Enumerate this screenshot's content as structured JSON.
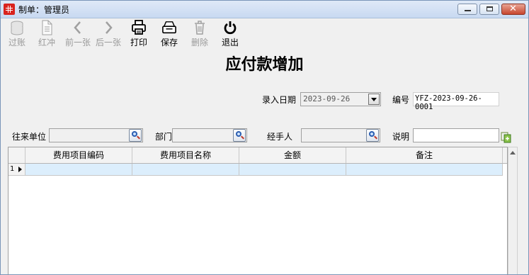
{
  "window": {
    "title": "制单：管理员"
  },
  "toolbar": {
    "items": [
      {
        "label": "过账",
        "icon": "coins-icon",
        "enabled": false
      },
      {
        "label": "红冲",
        "icon": "document-icon",
        "enabled": false
      },
      {
        "label": "前一张",
        "icon": "chevron-left-icon",
        "enabled": false
      },
      {
        "label": "后一张",
        "icon": "chevron-right-icon",
        "enabled": false
      },
      {
        "label": "打印",
        "icon": "printer-icon",
        "enabled": true
      },
      {
        "label": "保存",
        "icon": "save-box-icon",
        "enabled": true
      },
      {
        "label": "删除",
        "icon": "trash-icon",
        "enabled": false
      },
      {
        "label": "退出",
        "icon": "power-icon",
        "enabled": true
      }
    ]
  },
  "form": {
    "title": "应付款增加",
    "entry_date_label": "录入日期",
    "entry_date_value": "2023-09-26",
    "number_label": "编号",
    "number_value": "YFZ-2023-09-26-0001",
    "partner_label": "往来单位",
    "partner_value": "",
    "dept_label": "部门",
    "dept_value": "",
    "handler_label": "经手人",
    "handler_value": "",
    "note_label": "说明",
    "note_value": ""
  },
  "grid": {
    "columns": [
      "费用项目编码",
      "费用项目名称",
      "金额",
      "备注"
    ],
    "rows": [
      {
        "row_number": "1",
        "cells": [
          "",
          "",
          "",
          ""
        ]
      }
    ]
  }
}
